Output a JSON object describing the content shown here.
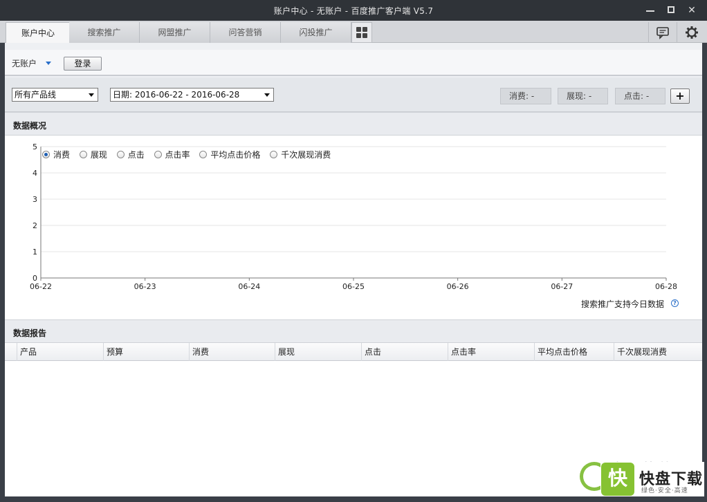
{
  "window": {
    "title": "账户中心 - 无账户 - 百度推广客户端 V5.7",
    "controls": [
      "minimize",
      "maximize",
      "close"
    ]
  },
  "tabs": [
    {
      "label": "账户中心",
      "active": true
    },
    {
      "label": "搜索推广",
      "active": false
    },
    {
      "label": "网盟推广",
      "active": false
    },
    {
      "label": "问答营销",
      "active": false
    },
    {
      "label": "闪投推广",
      "active": false
    }
  ],
  "toolbar_icons": [
    "apps-grid-icon",
    "message-icon",
    "gear-icon"
  ],
  "account": {
    "name": "无账户",
    "login_label": "登录"
  },
  "filters": {
    "product_line": "所有产品线",
    "date_range": "日期: 2016-06-22 - 2016-06-28"
  },
  "stats": {
    "spend": "消费: -",
    "impressions": "展现: -",
    "clicks": "点击: -",
    "add_label": "+"
  },
  "overview": {
    "title": "数据概况",
    "metrics": [
      {
        "label": "消费",
        "selected": true
      },
      {
        "label": "展现",
        "selected": false
      },
      {
        "label": "点击",
        "selected": false
      },
      {
        "label": "点击率",
        "selected": false
      },
      {
        "label": "平均点击价格",
        "selected": false
      },
      {
        "label": "千次展现消费",
        "selected": false
      }
    ],
    "hint": "搜索推广支持今日数据"
  },
  "chart_data": {
    "type": "line",
    "x": [
      "06-22",
      "06-23",
      "06-24",
      "06-25",
      "06-26",
      "06-27",
      "06-28"
    ],
    "series": [],
    "yticks": [
      "0",
      "1",
      "2",
      "3",
      "4",
      "5"
    ],
    "ylim": [
      0,
      5
    ],
    "grid": true,
    "title": "",
    "xlabel": "",
    "ylabel": ""
  },
  "report": {
    "title": "数据报告",
    "columns": [
      "产品",
      "预算",
      "消费",
      "展现",
      "点击",
      "点击率",
      "平均点击价格",
      "千次展现消费"
    ],
    "rows": []
  },
  "watermark": {
    "brand": "快盘下载",
    "slogan": "绿色·安全·高速",
    "kuai": "快",
    "site_text": "当下软件园"
  }
}
